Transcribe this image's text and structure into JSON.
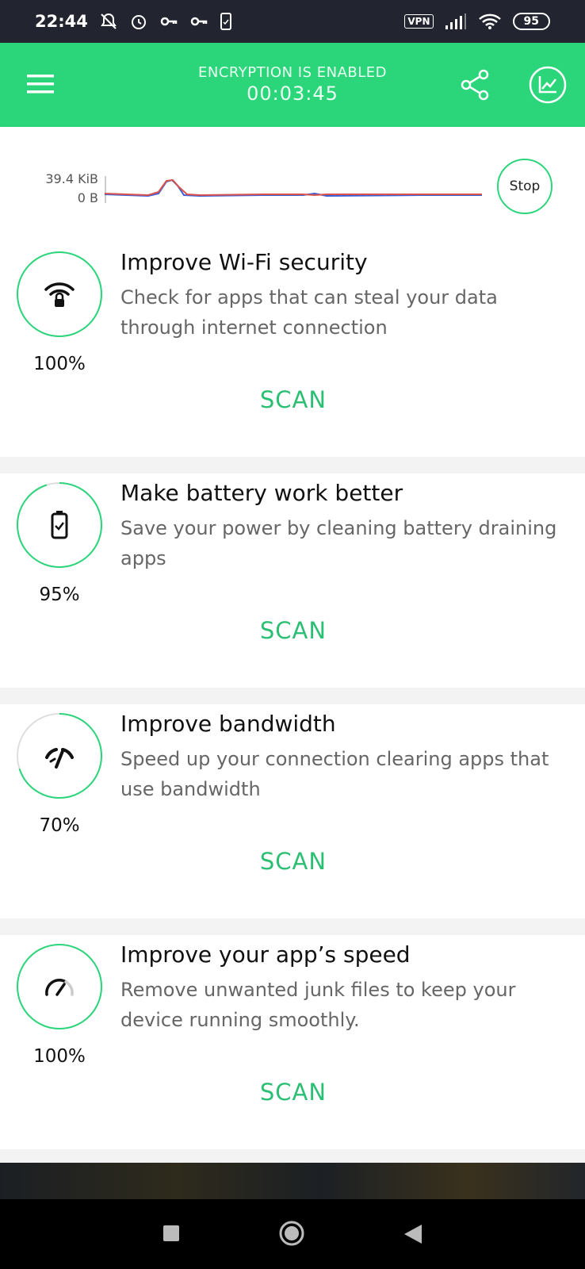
{
  "status_bar": {
    "time": "22:44",
    "vpn_label": "VPN",
    "battery": "95",
    "icons": [
      "bell-off-icon",
      "alarm-icon",
      "key-icon",
      "key-icon",
      "phone-icon",
      "signal-icon",
      "wifi-icon"
    ]
  },
  "header": {
    "encryption_status": "ENCRYPTION IS ENABLED",
    "timer": "00:03:45",
    "icons": [
      "menu-icon",
      "share-icon",
      "chart-icon"
    ]
  },
  "traffic": {
    "max_label": "39.4 KiB",
    "min_label": "0 B",
    "stop_label": "Stop",
    "series_colors": [
      "#3a5fd9",
      "#d9534f"
    ]
  },
  "cards": [
    {
      "title": "Improve Wi-Fi security",
      "description": "Check for apps that can steal your data through internet connection",
      "percent_text": "100%",
      "progress": 100,
      "action": "SCAN",
      "icon": "wifi-lock-icon"
    },
    {
      "title": "Make battery work better",
      "description": "Save your power by cleaning battery draining apps",
      "percent_text": "95%",
      "progress": 95,
      "action": "SCAN",
      "icon": "battery-check-icon"
    },
    {
      "title": "Improve bandwidth",
      "description": "Speed up your connection clearing apps that use bandwidth",
      "percent_text": "70%",
      "progress": 70,
      "action": "SCAN",
      "icon": "bandwidth-icon"
    },
    {
      "title": "Improve your app’s speed",
      "description": "Remove unwanted junk files to keep your device running smoothly.",
      "percent_text": "100%",
      "progress": 100,
      "action": "SCAN",
      "icon": "speedometer-icon"
    }
  ],
  "colors": {
    "accent": "#2bd67b",
    "scan_text": "#2bbf74",
    "status_bar": "#222530"
  }
}
